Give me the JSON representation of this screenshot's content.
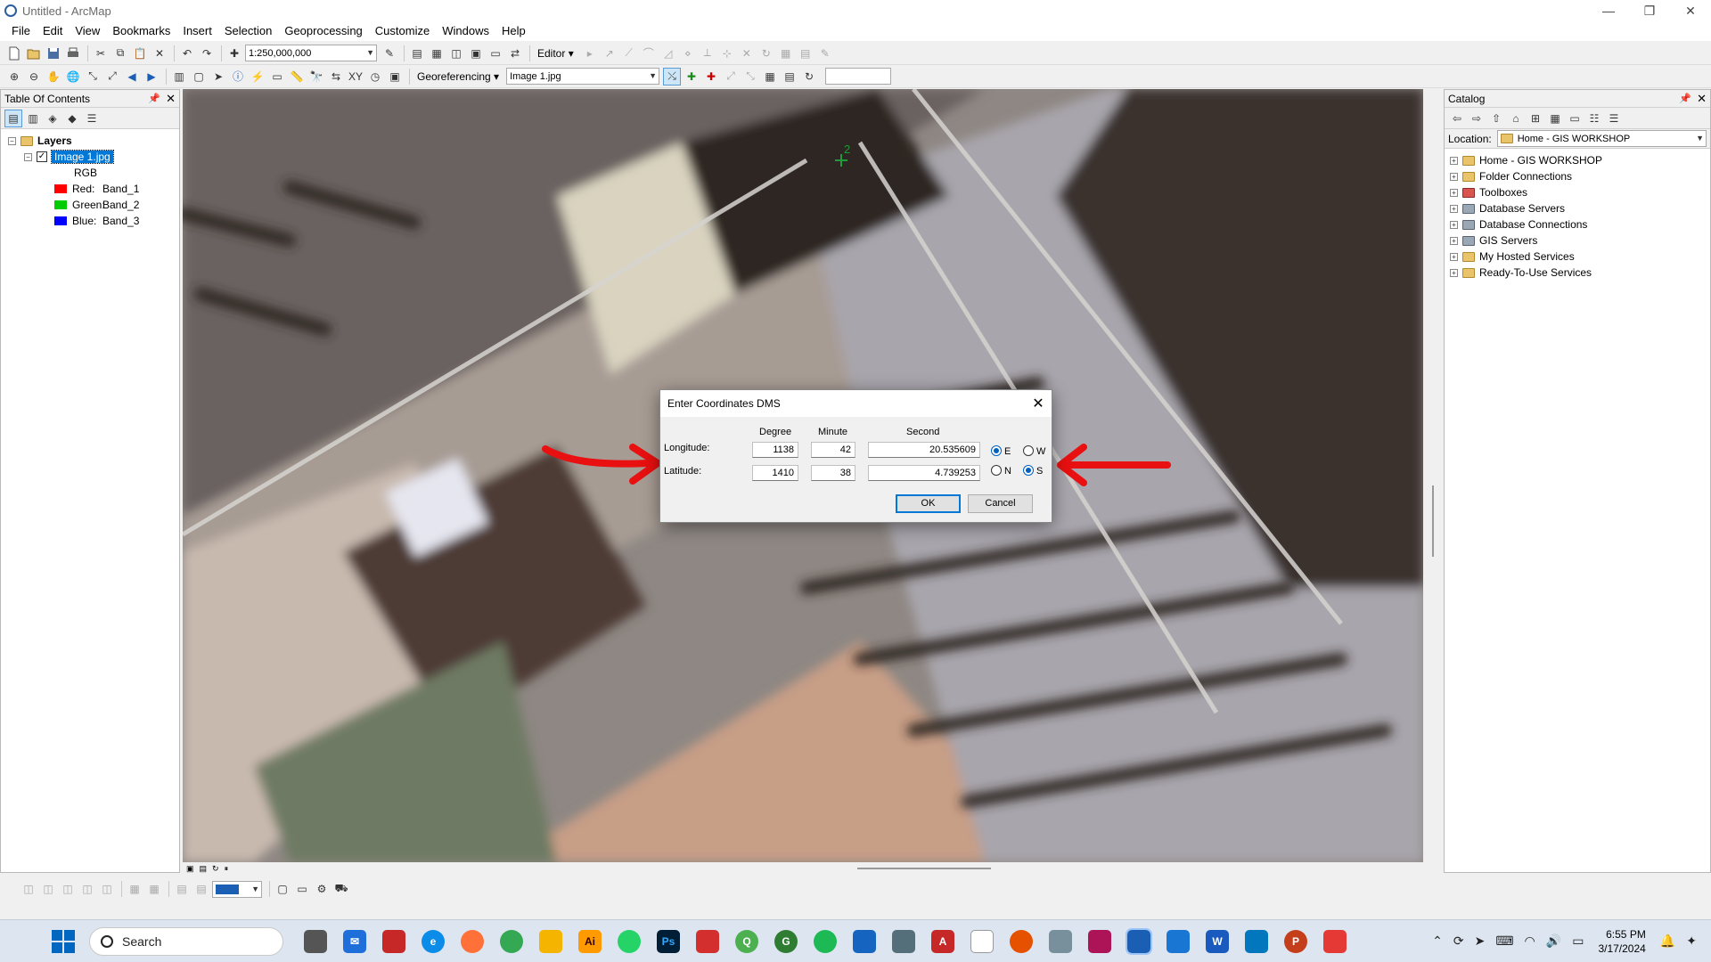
{
  "window": {
    "title": "Untitled - ArcMap"
  },
  "menu": [
    "File",
    "Edit",
    "View",
    "Bookmarks",
    "Insert",
    "Selection",
    "Geoprocessing",
    "Customize",
    "Windows",
    "Help"
  ],
  "toolbar": {
    "scale": "1:250,000,000",
    "editor_label": "Editor",
    "georef_label": "Georeferencing",
    "layer_combo": "Image 1.jpg"
  },
  "toc": {
    "title": "Table Of Contents",
    "root": "Layers",
    "layer": "Image 1.jpg",
    "rgb_label": "RGB",
    "bands": [
      {
        "label": "Red:",
        "band": "Band_1",
        "color": "#ff0000"
      },
      {
        "label": "Green:",
        "band": "Band_2",
        "color": "#00cc00"
      },
      {
        "label": "Blue:",
        "band": "Band_3",
        "color": "#0000ff"
      }
    ]
  },
  "map": {
    "control_point": "2",
    "arrow_color": "#e81010"
  },
  "catalog": {
    "title": "Catalog",
    "location_label": "Location:",
    "location_value": "Home - GIS WORKSHOP",
    "items": [
      "Home - GIS WORKSHOP",
      "Folder Connections",
      "Toolboxes",
      "Database Servers",
      "Database Connections",
      "GIS Servers",
      "My Hosted Services",
      "Ready-To-Use Services"
    ]
  },
  "dialog": {
    "title": "Enter Coordinates DMS",
    "col_degree": "Degree",
    "col_minute": "Minute",
    "col_second": "Second",
    "longitude": {
      "label": "Longitude:",
      "degree": "1138",
      "minute": "42",
      "second": "20.535609",
      "opt1": "E",
      "opt2": "W",
      "selected": "E"
    },
    "latitude": {
      "label": "Latitude:",
      "degree": "1410",
      "minute": "38",
      "second": "4.739253",
      "opt1": "N",
      "opt2": "S",
      "selected": "S"
    },
    "ok": "OK",
    "cancel": "Cancel"
  },
  "taskbar": {
    "search_placeholder": "Search",
    "time": "6:55 PM",
    "date": "3/17/2024"
  }
}
